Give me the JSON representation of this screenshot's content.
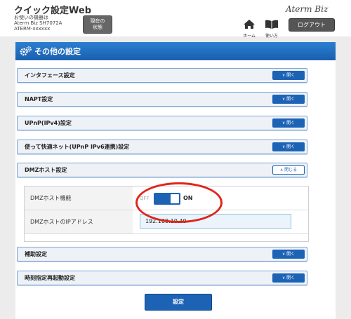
{
  "header": {
    "app_title": "クイック設定Web",
    "device_line1": "お使いの機器は",
    "device_line2": "Aterm Biz SH7072A",
    "device_line3": "ATERM-xxxxxx",
    "status_line1": "現在の",
    "status_line2": "状態",
    "brand": "Aterm Biz",
    "home_label": "ホーム",
    "guide_label": "使い方",
    "logout_label": "ログアウト"
  },
  "panel": {
    "title": "その他の設定"
  },
  "sections": [
    {
      "label": "インタフェース設定",
      "button": "開く"
    },
    {
      "label": "NAPT設定",
      "button": "開く"
    },
    {
      "label": "UPnP(IPv4)設定",
      "button": "開く"
    },
    {
      "label": "使って快適ネット(UPnP IPv6連携)設定",
      "button": "開く"
    },
    {
      "label": "DMZホスト設定",
      "button": "閉じる"
    },
    {
      "label": "補助設定",
      "button": "開く"
    },
    {
      "label": "時刻指定再起動設定",
      "button": "開く"
    }
  ],
  "dmz": {
    "function_label": "DMZホスト機能",
    "off_label": "OFF",
    "on_label": "ON",
    "ip_label": "DMZホストのIPアドレス",
    "ip_value": "192.168.10.40"
  },
  "submit_label": "設定",
  "colors": {
    "accent": "#1d63b5",
    "highlight": "#e0261b"
  }
}
